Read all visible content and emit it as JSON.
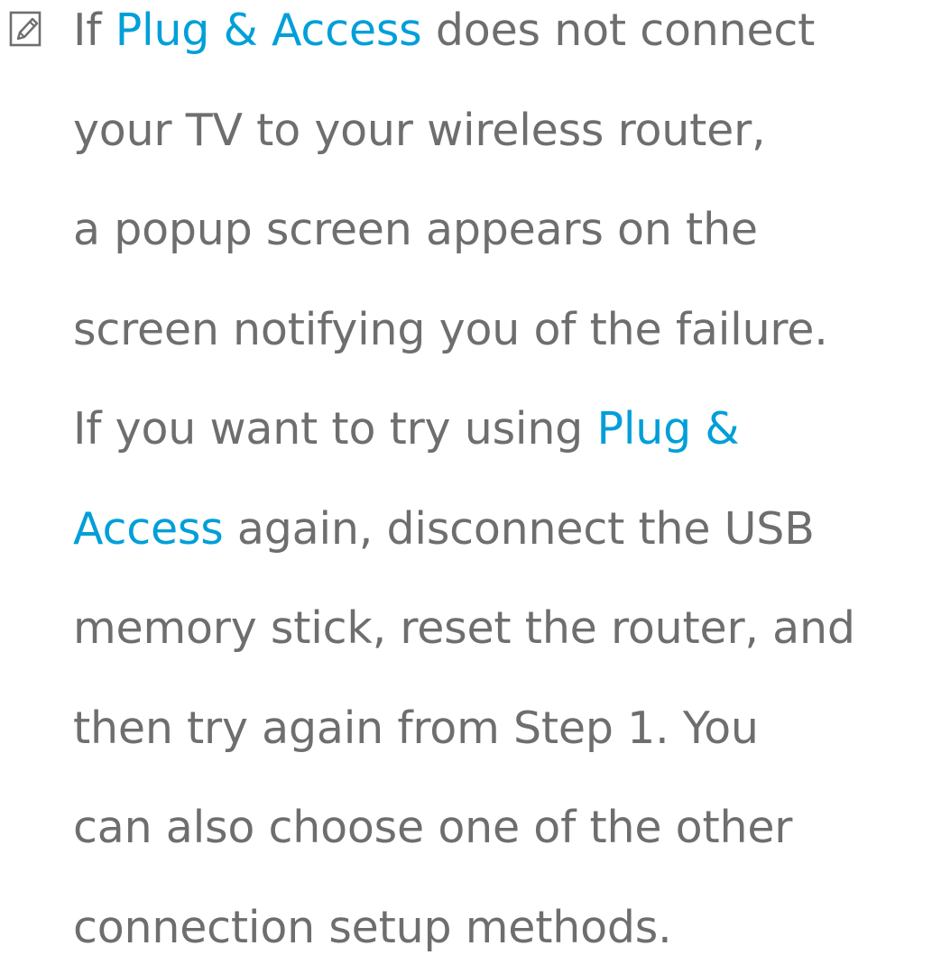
{
  "note": {
    "icon": "note-pencil-icon",
    "highlight_color": "#009fd9",
    "text_color": "#6e6e6e",
    "lines": [
      [
        {
          "t": "If "
        },
        {
          "t": "Plug & Access",
          "hl": true
        },
        {
          "t": " does not connect"
        }
      ],
      [
        {
          "t": "your TV to your wireless router,"
        }
      ],
      [
        {
          "t": "a popup screen appears on the"
        }
      ],
      [
        {
          "t": "screen notifying you of the failure."
        }
      ],
      [
        {
          "t": "If you want to try using "
        },
        {
          "t": "Plug &",
          "hl": true
        }
      ],
      [
        {
          "t": "Access",
          "hl": true
        },
        {
          "t": " again, disconnect the USB"
        }
      ],
      [
        {
          "t": "memory stick, reset the router, and"
        }
      ],
      [
        {
          "t": "then try again from Step 1. You"
        }
      ],
      [
        {
          "t": "can also choose one of the other"
        }
      ],
      [
        {
          "t": "connection setup methods."
        }
      ]
    ]
  }
}
